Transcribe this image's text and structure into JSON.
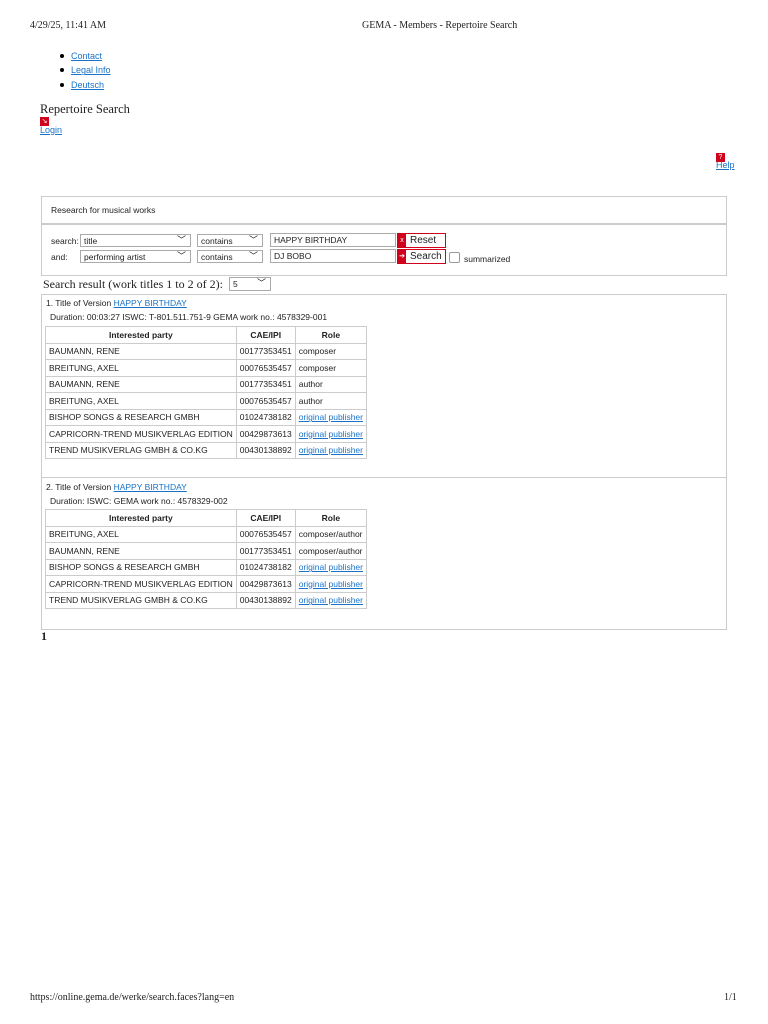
{
  "print_header": {
    "datetime": "4/29/25, 11:41 AM",
    "title": "GEMA - Members - Repertoire Search"
  },
  "nav": [
    {
      "label": "Contact"
    },
    {
      "label": "Legal Info"
    },
    {
      "label": "Deutsch"
    }
  ],
  "page_title": "Repertoire Search",
  "login": "Login",
  "help": "Help",
  "search_box": {
    "heading": "Research for musical works",
    "row1": {
      "label": "search:",
      "field": "title",
      "operator": "contains",
      "value": "HAPPY BIRTHDAY",
      "button": "Reset"
    },
    "row2": {
      "label": "and:",
      "field": "performing artist",
      "operator": "contains",
      "value": "DJ BOBO",
      "button": "Search"
    },
    "summarized_label": "summarized",
    "summarized_checked": false
  },
  "result_summary": "Search result (work titles 1 to 2 of 2):",
  "page_size": "5",
  "headers": [
    "Interested party",
    "CAE/IPI",
    "Role"
  ],
  "results": [
    {
      "num": "1. Title of Version",
      "title": "HAPPY BIRTHDAY",
      "details": "Duration: 00:03:27 ISWC: T-801.511.751-9 GEMA work no.: 4578329-001",
      "rows": [
        [
          "BAUMANN, RENE",
          "00177353451",
          "composer"
        ],
        [
          "BREITUNG, AXEL",
          "00076535457",
          "composer"
        ],
        [
          "BAUMANN, RENE",
          "00177353451",
          "author"
        ],
        [
          "BREITUNG, AXEL",
          "00076535457",
          "author"
        ],
        [
          "BISHOP SONGS & RESEARCH GMBH",
          "01024738182",
          "original publisher"
        ],
        [
          "CAPRICORN-TREND MUSIKVERLAG EDITION",
          "00429873613",
          "original publisher"
        ],
        [
          "TREND MUSIKVERLAG GMBH & CO.KG",
          "00430138892",
          "original publisher"
        ]
      ]
    },
    {
      "num": "2. Title of Version",
      "title": "HAPPY BIRTHDAY",
      "details": "Duration: ISWC: GEMA work no.: 4578329-002",
      "rows": [
        [
          "BREITUNG, AXEL",
          "00076535457",
          "composer/author"
        ],
        [
          "BAUMANN, RENE",
          "00177353451",
          "composer/author"
        ],
        [
          "BISHOP SONGS & RESEARCH GMBH",
          "01024738182",
          "original publisher"
        ],
        [
          "CAPRICORN-TREND MUSIKVERLAG EDITION",
          "00429873613",
          "original publisher"
        ],
        [
          "TREND MUSIKVERLAG GMBH & CO.KG",
          "00430138892",
          "original publisher"
        ]
      ]
    }
  ],
  "pagination": "1",
  "footer": {
    "url": "https://online.gema.de/werke/search.faces?lang=en",
    "page": "1/1"
  },
  "colors": {
    "accent": "#d0021b",
    "link": "#1a73c8"
  }
}
